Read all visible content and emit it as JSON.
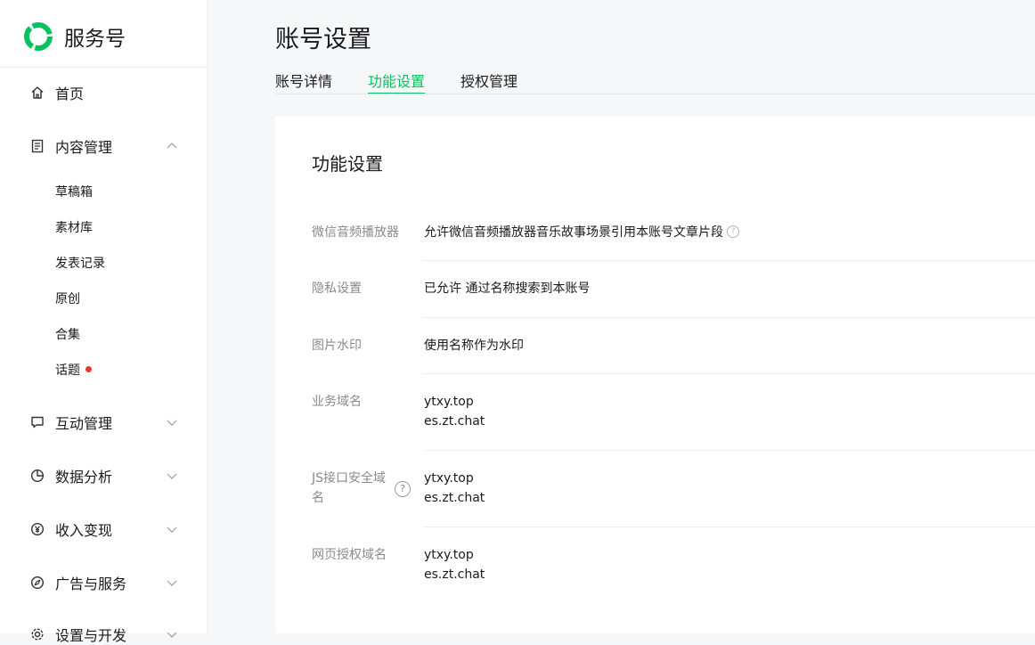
{
  "brand": {
    "name": "服务号",
    "logo_icon": "wechat-service-logo",
    "accent": "#07c160"
  },
  "sidebar": {
    "items": [
      {
        "label": "首页",
        "icon": "home-icon"
      },
      {
        "label": "内容管理",
        "icon": "document-icon",
        "expanded": true
      },
      {
        "label": "互动管理",
        "icon": "chat-icon"
      },
      {
        "label": "数据分析",
        "icon": "pie-chart-icon"
      },
      {
        "label": "收入变现",
        "icon": "yen-coin-icon"
      },
      {
        "label": "广告与服务",
        "icon": "compass-icon"
      },
      {
        "label": "设置与开发",
        "icon": "gear-icon"
      }
    ],
    "content_sub": [
      "草稿箱",
      "素材库",
      "发表记录",
      "原创",
      "合集",
      "话题"
    ],
    "topic_has_badge": true
  },
  "header": {
    "title": "账号设置",
    "tabs": [
      {
        "label": "账号详情",
        "active": false
      },
      {
        "label": "功能设置",
        "active": true
      },
      {
        "label": "授权管理",
        "active": false
      }
    ]
  },
  "main": {
    "section_title": "功能设置",
    "rows": [
      {
        "label": "微信音频播放器",
        "values": [
          "允许微信音频播放器音乐故事场景引用本账号文章片段"
        ],
        "help": true
      },
      {
        "label": "隐私设置",
        "values": [
          "已允许 通过名称搜索到本账号"
        ]
      },
      {
        "label": "图片水印",
        "values": [
          "使用名称作为水印"
        ]
      },
      {
        "label": "业务域名",
        "values": [
          "ytxy.top",
          "es.zt.chat"
        ]
      },
      {
        "label": "JS接口安全域名",
        "label_lines": [
          "JS接口安全域",
          "名"
        ],
        "values": [
          "ytxy.top",
          "es.zt.chat"
        ],
        "help": true
      },
      {
        "label": "网页授权域名",
        "values": [
          "ytxy.top",
          "es.zt.chat"
        ]
      }
    ]
  }
}
